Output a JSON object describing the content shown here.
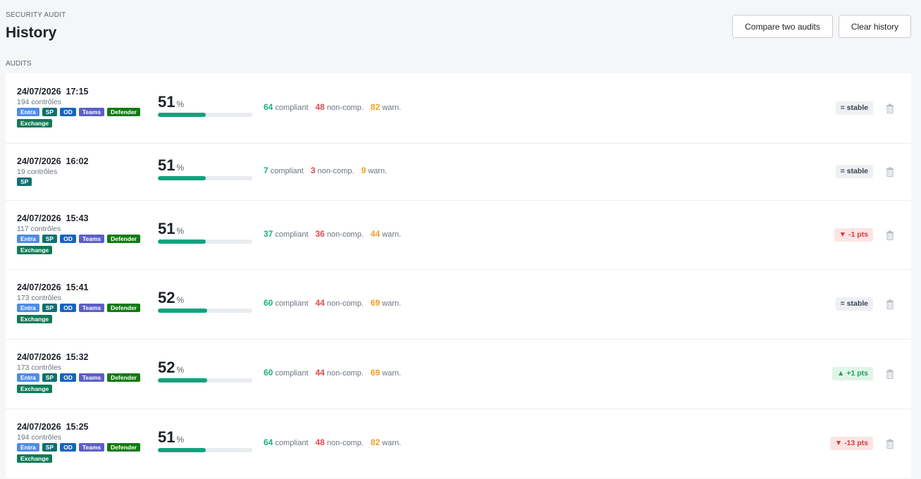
{
  "header": {
    "eyebrow": "SECURITY AUDIT",
    "title": "History",
    "compare_label": "Compare two audits",
    "clear_label": "Clear history"
  },
  "section_label": "AUDITS",
  "labels": {
    "compliant": "compliant",
    "noncomp": "non-comp.",
    "warn": "warn.",
    "pct": "%"
  },
  "tag_colors": {
    "Entra": "#4e8ce8",
    "SP": "#0e6f72",
    "OD": "#1565c0",
    "Teams": "#5b5fc7",
    "Defender": "#107c10",
    "Exchange": "#0f7b56"
  },
  "trend_colors": {
    "stable": "#eef0f3",
    "down": "#fde4e4",
    "up": "#dff5e8"
  },
  "audits": [
    {
      "date": "24/07/2026  17:15",
      "controls": "194 contrôles",
      "tags": [
        "Entra",
        "SP",
        "OD",
        "Teams",
        "Defender",
        "Exchange"
      ],
      "score": "51",
      "progress": 0.51,
      "compliant": "64",
      "noncomp": "48",
      "warn": "82",
      "trend": "= stable",
      "trend_type": "stable"
    },
    {
      "date": "24/07/2026  16:02",
      "controls": "19 contrôles",
      "tags": [
        "SP"
      ],
      "score": "51",
      "progress": 0.51,
      "compliant": "7",
      "noncomp": "3",
      "warn": "9",
      "trend": "= stable",
      "trend_type": "stable"
    },
    {
      "date": "24/07/2026  15:43",
      "controls": "117 contrôles",
      "tags": [
        "Entra",
        "SP",
        "OD",
        "Teams",
        "Defender",
        "Exchange"
      ],
      "score": "51",
      "progress": 0.51,
      "compliant": "37",
      "noncomp": "36",
      "warn": "44",
      "trend": "▼ -1 pts",
      "trend_type": "down"
    },
    {
      "date": "24/07/2026  15:41",
      "controls": "173 contrôles",
      "tags": [
        "Entra",
        "SP",
        "OD",
        "Teams",
        "Defender",
        "Exchange"
      ],
      "score": "52",
      "progress": 0.52,
      "compliant": "60",
      "noncomp": "44",
      "warn": "69",
      "trend": "= stable",
      "trend_type": "stable"
    },
    {
      "date": "24/07/2026  15:32",
      "controls": "173 contrôles",
      "tags": [
        "Entra",
        "SP",
        "OD",
        "Teams",
        "Defender",
        "Exchange"
      ],
      "score": "52",
      "progress": 0.52,
      "compliant": "60",
      "noncomp": "44",
      "warn": "69",
      "trend": "▲ +1 pts",
      "trend_type": "up"
    },
    {
      "date": "24/07/2026  15:25",
      "controls": "194 contrôles",
      "tags": [
        "Entra",
        "SP",
        "OD",
        "Teams",
        "Defender",
        "Exchange"
      ],
      "score": "51",
      "progress": 0.51,
      "compliant": "64",
      "noncomp": "48",
      "warn": "82",
      "trend": "▼ -13 pts",
      "trend_type": "down"
    }
  ]
}
